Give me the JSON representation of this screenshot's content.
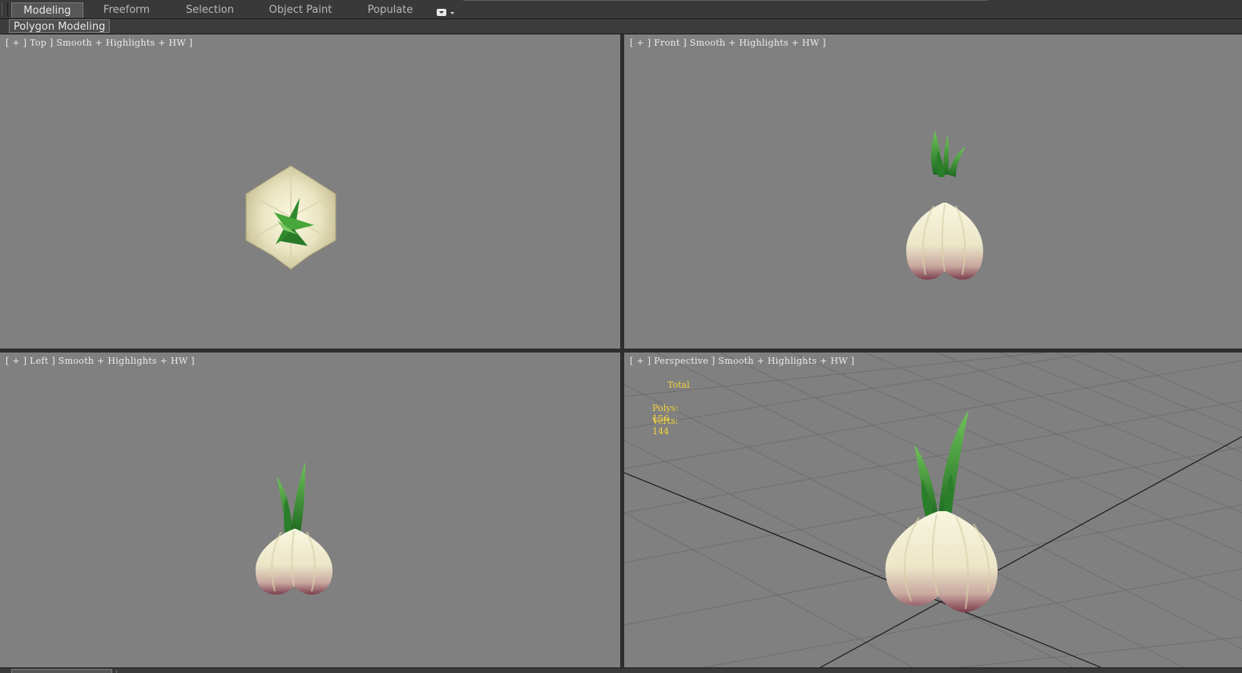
{
  "ribbon": {
    "tabs": [
      {
        "label": "Modeling",
        "active": true
      },
      {
        "label": "Freeform",
        "active": false
      },
      {
        "label": "Selection",
        "active": false
      },
      {
        "label": "Object Paint",
        "active": false
      },
      {
        "label": "Populate",
        "active": false
      }
    ],
    "dropdown_icon": "ribbon-options-icon",
    "subtab": {
      "label": "Polygon Modeling"
    }
  },
  "viewports": {
    "top": {
      "label": "[ + ] Top ] Smooth + Highlights + HW ]"
    },
    "front": {
      "label": "[ + ] Front ] Smooth + Highlights + HW ]"
    },
    "left": {
      "label": "[ + ] Left ] Smooth + Highlights + HW ]"
    },
    "perspective": {
      "label": "[ + ] Perspective ] Smooth + Highlights + HW ]",
      "stats": {
        "header": "Total",
        "polys_label": "Polys:",
        "polys_value": "156",
        "verts_label": "Verts:",
        "verts_value": "144"
      }
    }
  },
  "colors": {
    "viewport_bg": "#808080",
    "stats_text": "#f4d43a",
    "bulb_body": "#efeccf",
    "bulb_base": "#8a4d5a",
    "sprout": "#3f9a35"
  }
}
